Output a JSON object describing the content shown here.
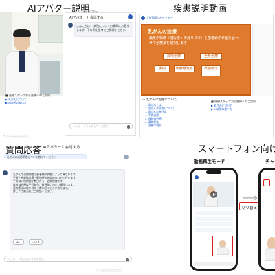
{
  "quadrants": {
    "q1": {
      "title": "AIアバター説明",
      "chat_header": "AIアバターと会話する",
      "topbar_label": "全画面で表示",
      "bot_message": "こんにちは！ 病院についての質問にお答えします。下の例を参考にご質問ください。",
      "notice_title": "■ 医療スタッフから皆様へのご案内",
      "links": [
        "▶ 乳がんについて",
        "▶ AI説明の使い方"
      ],
      "input_placeholder": "メッセージを入力してください",
      "footer": "© ○○○○○○○○○○"
    },
    "q2": {
      "title": "疾患説明動画",
      "logo_text": "大阪国際がんセンター",
      "slide_title": "乳がんの治療",
      "slide_sub": "病気の特徴（進行度・再発リスク）と患者様の希望を合わせて治療法を選択します",
      "boxes": [
        "局所治療",
        "全身治療",
        "手術",
        "放射線治療",
        "薬物療法"
      ],
      "section_label": "乳がんの治療について",
      "list_items": [
        "1. 乳がんとは",
        "2. 乳がんの診断について",
        "3. 乳がんの進行度",
        "4. 手術治療",
        "5. 放射線治療",
        "6. 薬物療法",
        "7. 治療の流れ"
      ],
      "notice_title": "■ 医療スタッフから皆様へのご案内",
      "links": [
        "▶ 乳がんについて",
        "▶ AI説明の使い方"
      ]
    },
    "q3": {
      "title": "質問応答",
      "chat_header": "AIアバターと会話する",
      "user_message": "乳がんの治療期間について教えてください",
      "answer_lines": [
        "乳がんの治療期間は患者様の状態によって異なります。",
        "手術・放射線治療・薬物療法を組み合わせて行います。",
        "手術は入院期間が数日から一週間程度です。",
        "放射線治療は平日毎日、数週間にわたり通院します。",
        "薬物療法は数か月から数年続くことがあります。",
        "詳しくは担当医にご相談ください。"
      ],
      "chips": [
        "はい",
        "いいえ"
      ],
      "input_placeholder": "メッセージを入力してください",
      "footer": "© ○○○○○○○○○○"
    },
    "q4": {
      "title": "スマートフォン向け",
      "mode_left": "動画再生モード",
      "mode_right": "チャ",
      "switch_label": "切り替え"
    }
  }
}
